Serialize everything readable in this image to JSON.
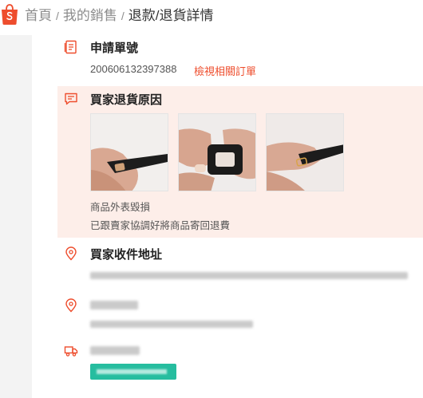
{
  "breadcrumb": {
    "home": "首頁",
    "my_sales": "我的銷售",
    "current": "退款/退貨詳情",
    "separator": "/"
  },
  "request": {
    "title": "申請單號",
    "number": "200606132397388",
    "view_order_link": "檢視相關訂單"
  },
  "reason": {
    "title": "買家退貨原因",
    "reason_text": "商品外表毀損",
    "note": "已跟賣家協調好將商品寄回退費",
    "photos": [
      "photo-1",
      "photo-2",
      "photo-3"
    ]
  },
  "address": {
    "title": "買家收件地址"
  },
  "colors": {
    "brand": "#ee4d2d",
    "reason_bg": "#fdeee9",
    "tracking_badge": "#26bd9f"
  },
  "icons": {
    "logo": "shopee-bag-icon",
    "request": "document-icon",
    "reason": "message-icon",
    "address": "location-pin-icon",
    "contact": "location-pin-icon",
    "shipping": "truck-icon"
  }
}
